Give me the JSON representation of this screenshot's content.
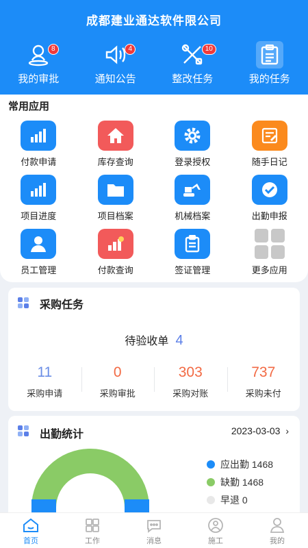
{
  "header": {
    "company": "成都建业通达软件限公司",
    "nav": [
      {
        "label": "我的审批",
        "badge": "8",
        "icon": "approval-icon"
      },
      {
        "label": "通知公告",
        "badge": "4",
        "icon": "speaker-icon"
      },
      {
        "label": "整改任务",
        "badge": "10",
        "icon": "tools-icon"
      },
      {
        "label": "我的任务",
        "badge": "",
        "icon": "clipboard-icon"
      }
    ]
  },
  "apps": {
    "title": "常用应用",
    "items": [
      {
        "label": "付款申请",
        "icon": "bar-chart-icon",
        "color": "#1c8cf8"
      },
      {
        "label": "库存查询",
        "icon": "house-icon",
        "color": "#f25a5a"
      },
      {
        "label": "登录授权",
        "icon": "gear-icon",
        "color": "#1c8cf8"
      },
      {
        "label": "随手日记",
        "icon": "note-icon",
        "color": "#fb8a1d"
      },
      {
        "label": "项目进度",
        "icon": "bar-chart-icon",
        "color": "#1c8cf8"
      },
      {
        "label": "项目档案",
        "icon": "folder-icon",
        "color": "#1c8cf8"
      },
      {
        "label": "机械档案",
        "icon": "excavator-icon",
        "color": "#1c8cf8"
      },
      {
        "label": "出勤申报",
        "icon": "check-icon",
        "color": "#1c8cf8"
      },
      {
        "label": "员工管理",
        "icon": "person-icon",
        "color": "#1c8cf8"
      },
      {
        "label": "付款查询",
        "icon": "coins-icon",
        "color": "#f25a5a"
      },
      {
        "label": "签证管理",
        "icon": "clipboard-icon",
        "color": "#1c8cf8"
      },
      {
        "label": "更多应用",
        "icon": "grid-icon",
        "color": "#c8c8c8"
      }
    ]
  },
  "purchase": {
    "title": "采购任务",
    "pending_label": "待验收单",
    "pending_value": "4",
    "stats": [
      {
        "value": "11",
        "label": "采购申请",
        "color": "#6b8ee6"
      },
      {
        "value": "0",
        "label": "采购审批",
        "color": "#f26a44"
      },
      {
        "value": "303",
        "label": "采购对账",
        "color": "#f26a44"
      },
      {
        "value": "737",
        "label": "采购未付",
        "color": "#f26a44"
      }
    ]
  },
  "attendance": {
    "title": "出勤统计",
    "date": "2023-03-03",
    "legend": [
      {
        "label": "应出勤 1468",
        "color": "#1c8cf8"
      },
      {
        "label": "缺勤 1468",
        "color": "#8acb66"
      },
      {
        "label": "早退 0",
        "color": "#e8e8e8"
      }
    ]
  },
  "tabs": [
    {
      "label": "首页",
      "icon": "home-icon",
      "active": true
    },
    {
      "label": "工作",
      "icon": "work-icon",
      "active": false
    },
    {
      "label": "消息",
      "icon": "message-icon",
      "active": false
    },
    {
      "label": "施工",
      "icon": "construction-icon",
      "active": false
    },
    {
      "label": "我的",
      "icon": "profile-icon",
      "active": false
    }
  ]
}
